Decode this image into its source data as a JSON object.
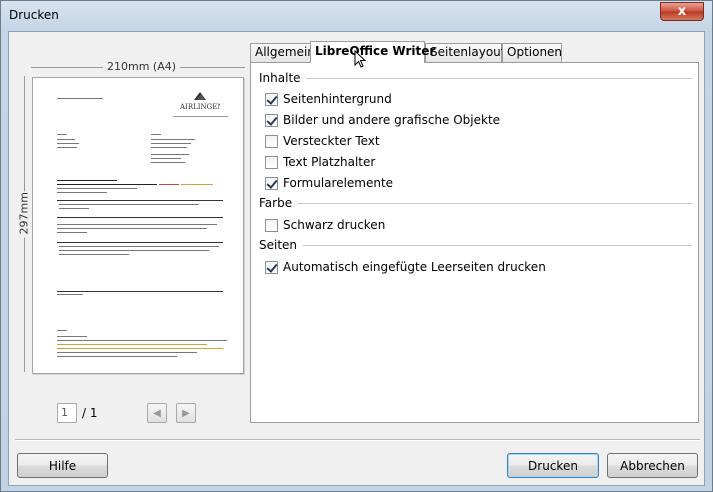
{
  "window": {
    "title": "Drucken",
    "close_label": "x"
  },
  "preview": {
    "width_label": "210mm (A4)",
    "height_label": "297mm",
    "page_current": "1",
    "page_total": "/ 1"
  },
  "tabs": [
    {
      "label": "Allgemein",
      "active": false
    },
    {
      "label": "LibreOffice Writer",
      "active": true
    },
    {
      "label": "Seitenlayout",
      "active": false
    },
    {
      "label": "Optionen",
      "active": false
    }
  ],
  "sections": {
    "inhalte": {
      "heading": "Inhalte",
      "items": [
        {
          "label": "Seitenhintergrund",
          "checked": true
        },
        {
          "label": "Bilder und andere grafische Objekte",
          "checked": true
        },
        {
          "label": "Versteckter Text",
          "checked": false
        },
        {
          "label": "Text Platzhalter",
          "checked": false
        },
        {
          "label": "Formularelemente",
          "checked": true
        }
      ]
    },
    "farbe": {
      "heading": "Farbe",
      "items": [
        {
          "label": "Schwarz drucken",
          "checked": false
        }
      ]
    },
    "seiten": {
      "heading": "Seiten",
      "items": [
        {
          "label": "Automatisch eingefügte Leerseiten drucken",
          "checked": true
        }
      ]
    }
  },
  "buttons": {
    "help": "Hilfe",
    "print": "Drucken",
    "cancel": "Abbrechen"
  },
  "preview_logo_text": "AIRLINGEN"
}
